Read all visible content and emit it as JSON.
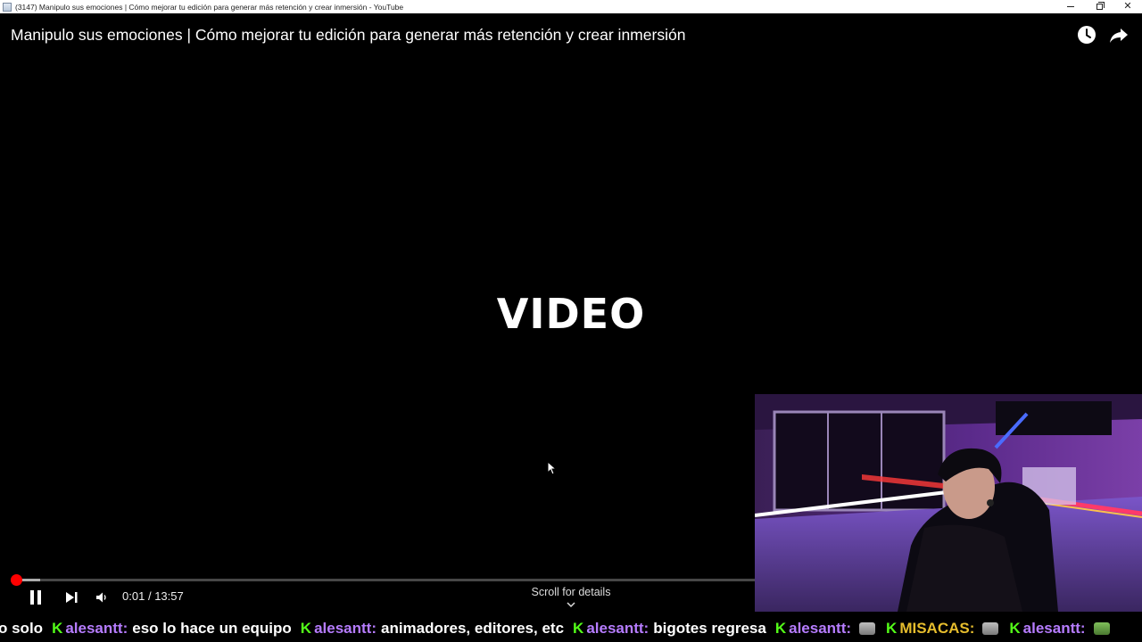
{
  "window": {
    "title": "(3147) Manipulo sus emociones | Cómo mejorar tu edición para generar más retención y crear inmersión - YouTube",
    "controls": [
      "minimize",
      "maximize",
      "close"
    ]
  },
  "player": {
    "video_title": "Manipulo sus emociones | Cómo mejorar tu edición para generar más retención y crear inmersión",
    "top_icons": [
      "clock-icon",
      "share-icon"
    ],
    "center_text": "VIDEO",
    "progress_fraction": 0.0012,
    "time_current": "0:01",
    "time_separator": "/",
    "time_total": "13:57",
    "scroll_hint": "Scroll for details",
    "accent_color": "#ff0000"
  },
  "ticker": {
    "leading_text": "o solo",
    "messages": [
      {
        "user": "alesantt:",
        "text": "eso lo hace un equipo",
        "emote": null,
        "user_color": "#b67cff"
      },
      {
        "user": "alesantt:",
        "text": "animadores, editores, etc",
        "emote": null,
        "user_color": "#b67cff"
      },
      {
        "user": "alesantt:",
        "text": "bigotes regresa",
        "emote": null,
        "user_color": "#b67cff"
      },
      {
        "user": "alesantt:",
        "text": "",
        "emote": "cat-emote",
        "user_color": "#b67cff"
      },
      {
        "user": "MISACAS:",
        "text": "",
        "emote": "cat-emote",
        "user_color": "#e6bd2d"
      },
      {
        "user": "alesantt:",
        "text": "",
        "emote": "frog-emote",
        "user_color": "#b67cff"
      }
    ],
    "badge_icon": "kick-badge-icon",
    "badge_color": "#53fc18"
  }
}
